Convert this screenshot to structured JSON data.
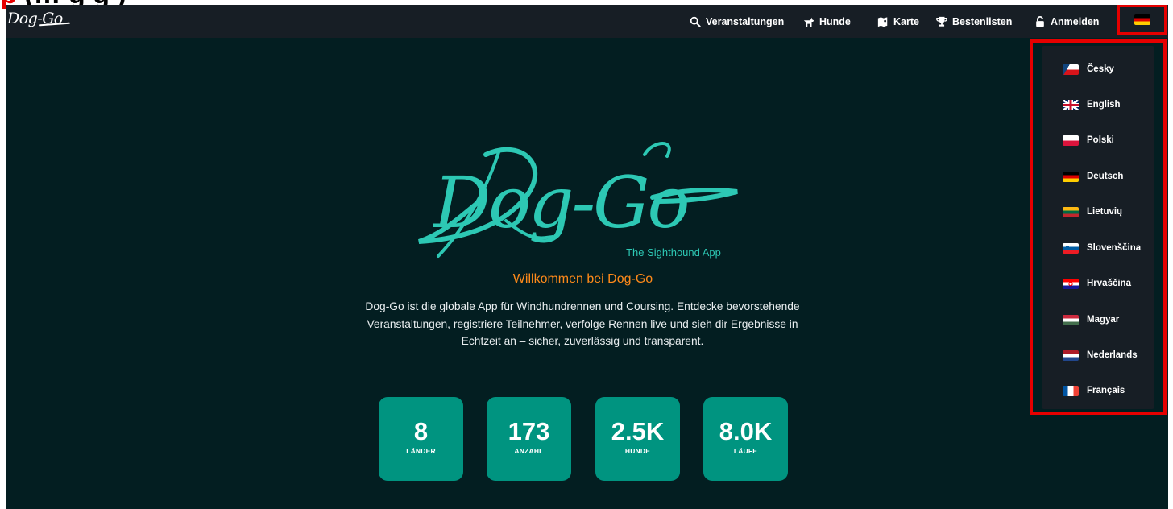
{
  "caption": {
    "prefix": "p",
    "suffix": " (…         g g )"
  },
  "brand": {
    "name": "Dog-Go"
  },
  "nav": {
    "items": [
      {
        "label": "Veranstaltungen",
        "icon": "search-icon"
      },
      {
        "label": "Hunde",
        "icon": "dog-icon"
      },
      {
        "label": "Karte",
        "icon": "map-icon"
      },
      {
        "label": "Bestenlisten",
        "icon": "trophy-icon"
      },
      {
        "label": "Anmelden",
        "icon": "lock-icon"
      }
    ],
    "language_button": {
      "selected": "Deutsch",
      "icon": "flag-de-icon"
    }
  },
  "hero": {
    "logo_text": "Dog-Go",
    "logo_tagline": "The Sighthound App",
    "welcome": "Willkommen bei Dog-Go",
    "description": "Dog-Go ist die globale App für Windhundrennen und Coursing. Entdecke bevorstehende Veranstaltungen, registriere Teilnehmer, verfolge Rennen live und sieh dir Ergebnisse in Echtzeit an – sicher, zuverlässig und transparent."
  },
  "stats": [
    {
      "value": "8",
      "label": "LÄNDER"
    },
    {
      "value": "173",
      "label": "ANZAHL"
    },
    {
      "value": "2.5K",
      "label": "HUNDE"
    },
    {
      "value": "8.0K",
      "label": "LÄUFE"
    }
  ],
  "languages": [
    {
      "label": "Česky",
      "icon": "flag-cz-icon"
    },
    {
      "label": "English",
      "icon": "flag-gb-icon"
    },
    {
      "label": "Polski",
      "icon": "flag-pl-icon"
    },
    {
      "label": "Deutsch",
      "icon": "flag-de-icon"
    },
    {
      "label": "Lietuvių",
      "icon": "flag-lt-icon"
    },
    {
      "label": "Slovenščina",
      "icon": "flag-si-icon"
    },
    {
      "label": "Hrvaščina",
      "icon": "flag-hr-icon"
    },
    {
      "label": "Magyar",
      "icon": "flag-hu-icon"
    },
    {
      "label": "Nederlands",
      "icon": "flag-nl-icon"
    },
    {
      "label": "Français",
      "icon": "flag-fr-icon"
    }
  ],
  "colors": {
    "background": "#031e21",
    "navbar": "#171e25",
    "accent": "#2dc8b4",
    "stat_tile": "#009480",
    "welcome": "#ff8a1a",
    "highlight": "#e60000"
  }
}
